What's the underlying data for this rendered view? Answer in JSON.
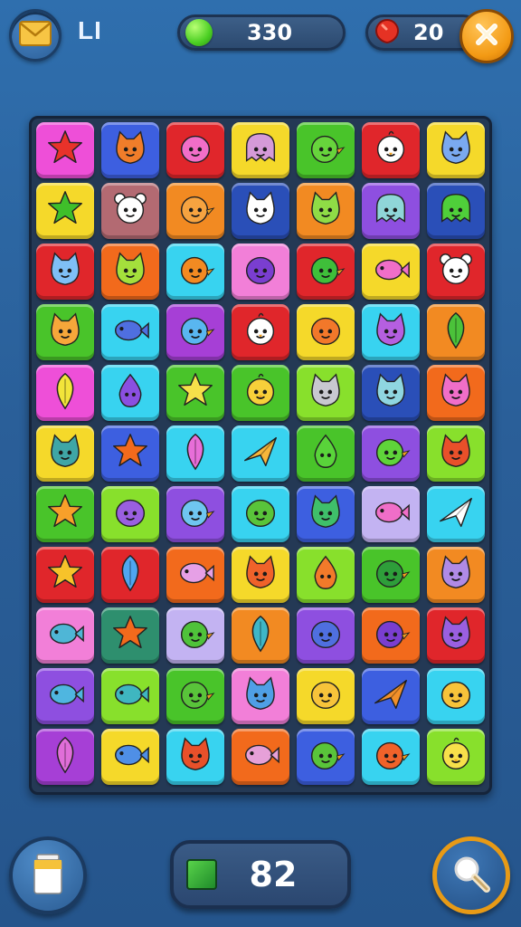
{
  "hud": {
    "player_label": "LI",
    "coins": "330",
    "gems": "20",
    "moves": "82",
    "icons": {
      "mail": "mail-icon",
      "coin": "green-coin-icon",
      "gem": "red-gem-icon",
      "close": "close-icon",
      "trash": "trash-icon",
      "moves": "green-square-icon",
      "search": "magnifier-icon"
    }
  },
  "board": {
    "rows": 11,
    "cols": 7,
    "colors": {
      "magenta": "#ee4fd8",
      "blue": "#3d5fe0",
      "red": "#e0262b",
      "yellow": "#f5d92a",
      "green": "#49c42a",
      "purple": "#8e4fe0",
      "orange": "#f28a22",
      "cyan": "#38d3f0",
      "lime": "#88e02c",
      "pink": "#f27fd8",
      "teal": "#2e8f6e",
      "rose": "#b36a72",
      "lavender": "#c3b3f2",
      "darkblue": "#2a4fb8",
      "violet": "#a63fd6",
      "tangerine": "#f26a1c"
    },
    "tiles": [
      [
        {
          "bg": "magenta",
          "c": "star",
          "fg": "#e8322a"
        },
        {
          "bg": "blue",
          "c": "cat",
          "fg": "#f07d2a"
        },
        {
          "bg": "red",
          "c": "blob",
          "fg": "#f26ec8"
        },
        {
          "bg": "yellow",
          "c": "ghost",
          "fg": "#d59ad8"
        },
        {
          "bg": "green",
          "c": "bird",
          "fg": "#67d43c"
        },
        {
          "bg": "red",
          "c": "chick",
          "fg": "#ffffff"
        },
        {
          "bg": "yellow",
          "c": "cat",
          "fg": "#7aa9f0"
        }
      ],
      [
        {
          "bg": "yellow",
          "c": "star",
          "fg": "#3fbf2a"
        },
        {
          "bg": "rose",
          "c": "bear",
          "fg": "#ffffff"
        },
        {
          "bg": "orange",
          "c": "bird",
          "fg": "#f6a340"
        },
        {
          "bg": "darkblue",
          "c": "cat",
          "fg": "#ffffff"
        },
        {
          "bg": "orange",
          "c": "cat",
          "fg": "#8fdc46"
        },
        {
          "bg": "purple",
          "c": "ghost",
          "fg": "#8fd6d8"
        },
        {
          "bg": "darkblue",
          "c": "ghost",
          "fg": "#4fcf3a"
        }
      ],
      [
        {
          "bg": "red",
          "c": "cat",
          "fg": "#7fbff6"
        },
        {
          "bg": "tangerine",
          "c": "cat",
          "fg": "#a4e03c"
        },
        {
          "bg": "cyan",
          "c": "bird",
          "fg": "#f28a22"
        },
        {
          "bg": "pink",
          "c": "blob",
          "fg": "#7a3ed0"
        },
        {
          "bg": "red",
          "c": "bird",
          "fg": "#3fbf3a"
        },
        {
          "bg": "yellow",
          "c": "fish",
          "fg": "#f06ec8"
        },
        {
          "bg": "red",
          "c": "bear",
          "fg": "#ffffff"
        }
      ],
      [
        {
          "bg": "green",
          "c": "cat",
          "fg": "#f7a73a"
        },
        {
          "bg": "cyan",
          "c": "fish",
          "fg": "#4f6fe0"
        },
        {
          "bg": "violet",
          "c": "bird",
          "fg": "#59b6f0"
        },
        {
          "bg": "red",
          "c": "chick",
          "fg": "#ffffff"
        },
        {
          "bg": "yellow",
          "c": "blob",
          "fg": "#f2782a"
        },
        {
          "bg": "cyan",
          "c": "cat",
          "fg": "#b55fe0"
        },
        {
          "bg": "orange",
          "c": "leaf",
          "fg": "#4bc23a"
        }
      ],
      [
        {
          "bg": "magenta",
          "c": "leaf",
          "fg": "#f2e43a"
        },
        {
          "bg": "cyan",
          "c": "drop",
          "fg": "#8a4fe0"
        },
        {
          "bg": "green",
          "c": "star",
          "fg": "#f7e04a"
        },
        {
          "bg": "green",
          "c": "chick",
          "fg": "#f7d03a"
        },
        {
          "bg": "lime",
          "c": "cat",
          "fg": "#c8c8d0"
        },
        {
          "bg": "darkblue",
          "c": "cat",
          "fg": "#8fd6e0"
        },
        {
          "bg": "tangerine",
          "c": "cat",
          "fg": "#f06ec8"
        }
      ],
      [
        {
          "bg": "yellow",
          "c": "cat",
          "fg": "#3fa6a6"
        },
        {
          "bg": "blue",
          "c": "star",
          "fg": "#f26a1c"
        },
        {
          "bg": "cyan",
          "c": "leaf",
          "fg": "#e76ed8"
        },
        {
          "bg": "cyan",
          "c": "plane",
          "fg": "#f7b63a"
        },
        {
          "bg": "green",
          "c": "drop",
          "fg": "#59d43a"
        },
        {
          "bg": "purple",
          "c": "bird",
          "fg": "#5fd43a"
        },
        {
          "bg": "lime",
          "c": "cat",
          "fg": "#e8502a"
        }
      ],
      [
        {
          "bg": "green",
          "c": "star",
          "fg": "#f7a02a"
        },
        {
          "bg": "lime",
          "c": "blob",
          "fg": "#9a5fe0"
        },
        {
          "bg": "purple",
          "c": "bird",
          "fg": "#6fc6f0"
        },
        {
          "bg": "cyan",
          "c": "blob",
          "fg": "#59c43a"
        },
        {
          "bg": "blue",
          "c": "cat",
          "fg": "#3fbf6a"
        },
        {
          "bg": "lavender",
          "c": "fish",
          "fg": "#f06ec8"
        },
        {
          "bg": "cyan",
          "c": "plane",
          "fg": "#ffffff"
        }
      ],
      [
        {
          "bg": "red",
          "c": "star",
          "fg": "#f7c32a"
        },
        {
          "bg": "red",
          "c": "leaf",
          "fg": "#4fa6f0"
        },
        {
          "bg": "tangerine",
          "c": "fish",
          "fg": "#e6a0e6"
        },
        {
          "bg": "yellow",
          "c": "cat",
          "fg": "#f0622a"
        },
        {
          "bg": "lime",
          "c": "drop",
          "fg": "#f27a2a"
        },
        {
          "bg": "green",
          "c": "bird",
          "fg": "#2e9e3a"
        },
        {
          "bg": "orange",
          "c": "cat",
          "fg": "#b08ae6"
        }
      ],
      [
        {
          "bg": "pink",
          "c": "fish",
          "fg": "#4fb6d6"
        },
        {
          "bg": "teal",
          "c": "star",
          "fg": "#f26a1c"
        },
        {
          "bg": "lavender",
          "c": "bird",
          "fg": "#4fc23a"
        },
        {
          "bg": "orange",
          "c": "leaf",
          "fg": "#3fb6c6"
        },
        {
          "bg": "purple",
          "c": "blob",
          "fg": "#4f6fe0"
        },
        {
          "bg": "tangerine",
          "c": "bird",
          "fg": "#7a3ed0"
        },
        {
          "bg": "red",
          "c": "cat",
          "fg": "#9a5fe0"
        }
      ],
      [
        {
          "bg": "purple",
          "c": "fish",
          "fg": "#4fb6e0"
        },
        {
          "bg": "lime",
          "c": "fish",
          "fg": "#3fb6c0"
        },
        {
          "bg": "green",
          "c": "bird",
          "fg": "#59c43a"
        },
        {
          "bg": "pink",
          "c": "cat",
          "fg": "#4f9fe6"
        },
        {
          "bg": "yellow",
          "c": "blob",
          "fg": "#f7c33a"
        },
        {
          "bg": "blue",
          "c": "plane",
          "fg": "#f2902a"
        },
        {
          "bg": "cyan",
          "c": "blob",
          "fg": "#f7c33a"
        }
      ],
      [
        {
          "bg": "violet",
          "c": "leaf",
          "fg": "#e06ed8"
        },
        {
          "bg": "yellow",
          "c": "fish",
          "fg": "#4f8fe6"
        },
        {
          "bg": "cyan",
          "c": "cat",
          "fg": "#e8502a"
        },
        {
          "bg": "tangerine",
          "c": "fish",
          "fg": "#e6a0d8"
        },
        {
          "bg": "blue",
          "c": "bird",
          "fg": "#59c43a"
        },
        {
          "bg": "cyan",
          "c": "bird",
          "fg": "#f0622a"
        },
        {
          "bg": "lime",
          "c": "chick",
          "fg": "#f7e04a"
        }
      ]
    ]
  }
}
